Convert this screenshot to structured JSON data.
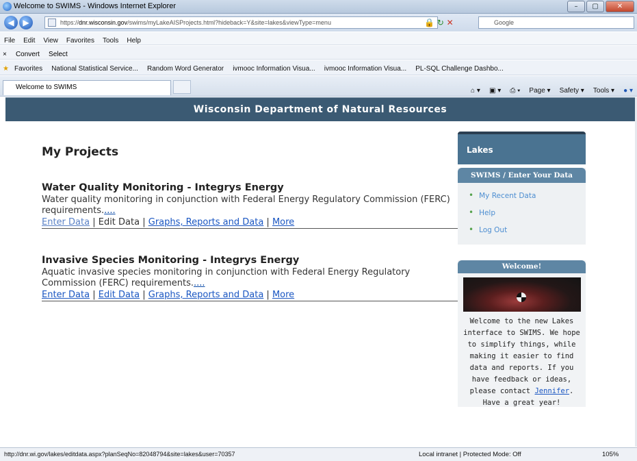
{
  "window": {
    "title": "Welcome to SWIMS - Windows Internet Explorer",
    "min": "–",
    "max": "▢",
    "close": "✕"
  },
  "address": {
    "host": "dnr.wisconsin.gov",
    "prefix": "https://",
    "path": "/swims/myLakeAISProjects.html?hideback=Y&site=lakes&viewType=menu",
    "search_placeholder": "Google"
  },
  "menu": [
    "File",
    "Edit",
    "View",
    "Favorites",
    "Tools",
    "Help"
  ],
  "convert": {
    "close": "×",
    "convert": "Convert",
    "select": "Select"
  },
  "favorites": {
    "label": "Favorites",
    "items": [
      "National Statistical Service...",
      "Random Word Generator",
      "ivmooc Information Visua...",
      "ivmooc Information Visua...",
      "PL-SQL Challenge Dashbo..."
    ]
  },
  "tab": {
    "title": "Welcome to SWIMS"
  },
  "commands": [
    "Page ▾",
    "Safety ▾",
    "Tools ▾"
  ],
  "banner": {
    "title": "Wisconsin Department of Natural Resources"
  },
  "main": {
    "heading": "My Projects",
    "projects": [
      {
        "title": "Water Quality Monitoring - Integrys Energy",
        "description": "Water quality monitoring in conjunction with Federal Energy Regulatory Commission (FERC) requirements.",
        "more_dots": "....",
        "links": [
          "Enter Data",
          "Edit Data",
          "Graphs, Reports and Data",
          "More"
        ]
      },
      {
        "title": "Invasive Species Monitoring - Integrys Energy",
        "description": "Aquatic invasive species monitoring in conjunction with Federal Energy Regulatory Commission (FERC) requirements.",
        "more_dots": "....",
        "links": [
          "Enter Data",
          "Edit Data",
          "Graphs, Reports and Data",
          "More"
        ]
      }
    ]
  },
  "sidebar": {
    "lakes": "Lakes",
    "swims_header": "SWIMS / Enter Your Data",
    "swims_items": [
      "My Recent Data",
      "Help",
      "Log Out"
    ],
    "welcome_header": "Welcome!",
    "welcome_text_1": "Welcome to the new Lakes interface to SWIMS. We hope to simplify things, while making it easier to find data and reports. If you have feedback or ideas, please contact",
    "welcome_link": "Jennifer",
    "welcome_text_2": ". Have a great year!"
  },
  "status": {
    "url": "http://dnr.wi.gov/lakes/editdata.aspx?planSeqNo=82048794&site=lakes&user=70357",
    "zone": "Local intranet | Protected Mode: Off",
    "zoom": "105%"
  }
}
